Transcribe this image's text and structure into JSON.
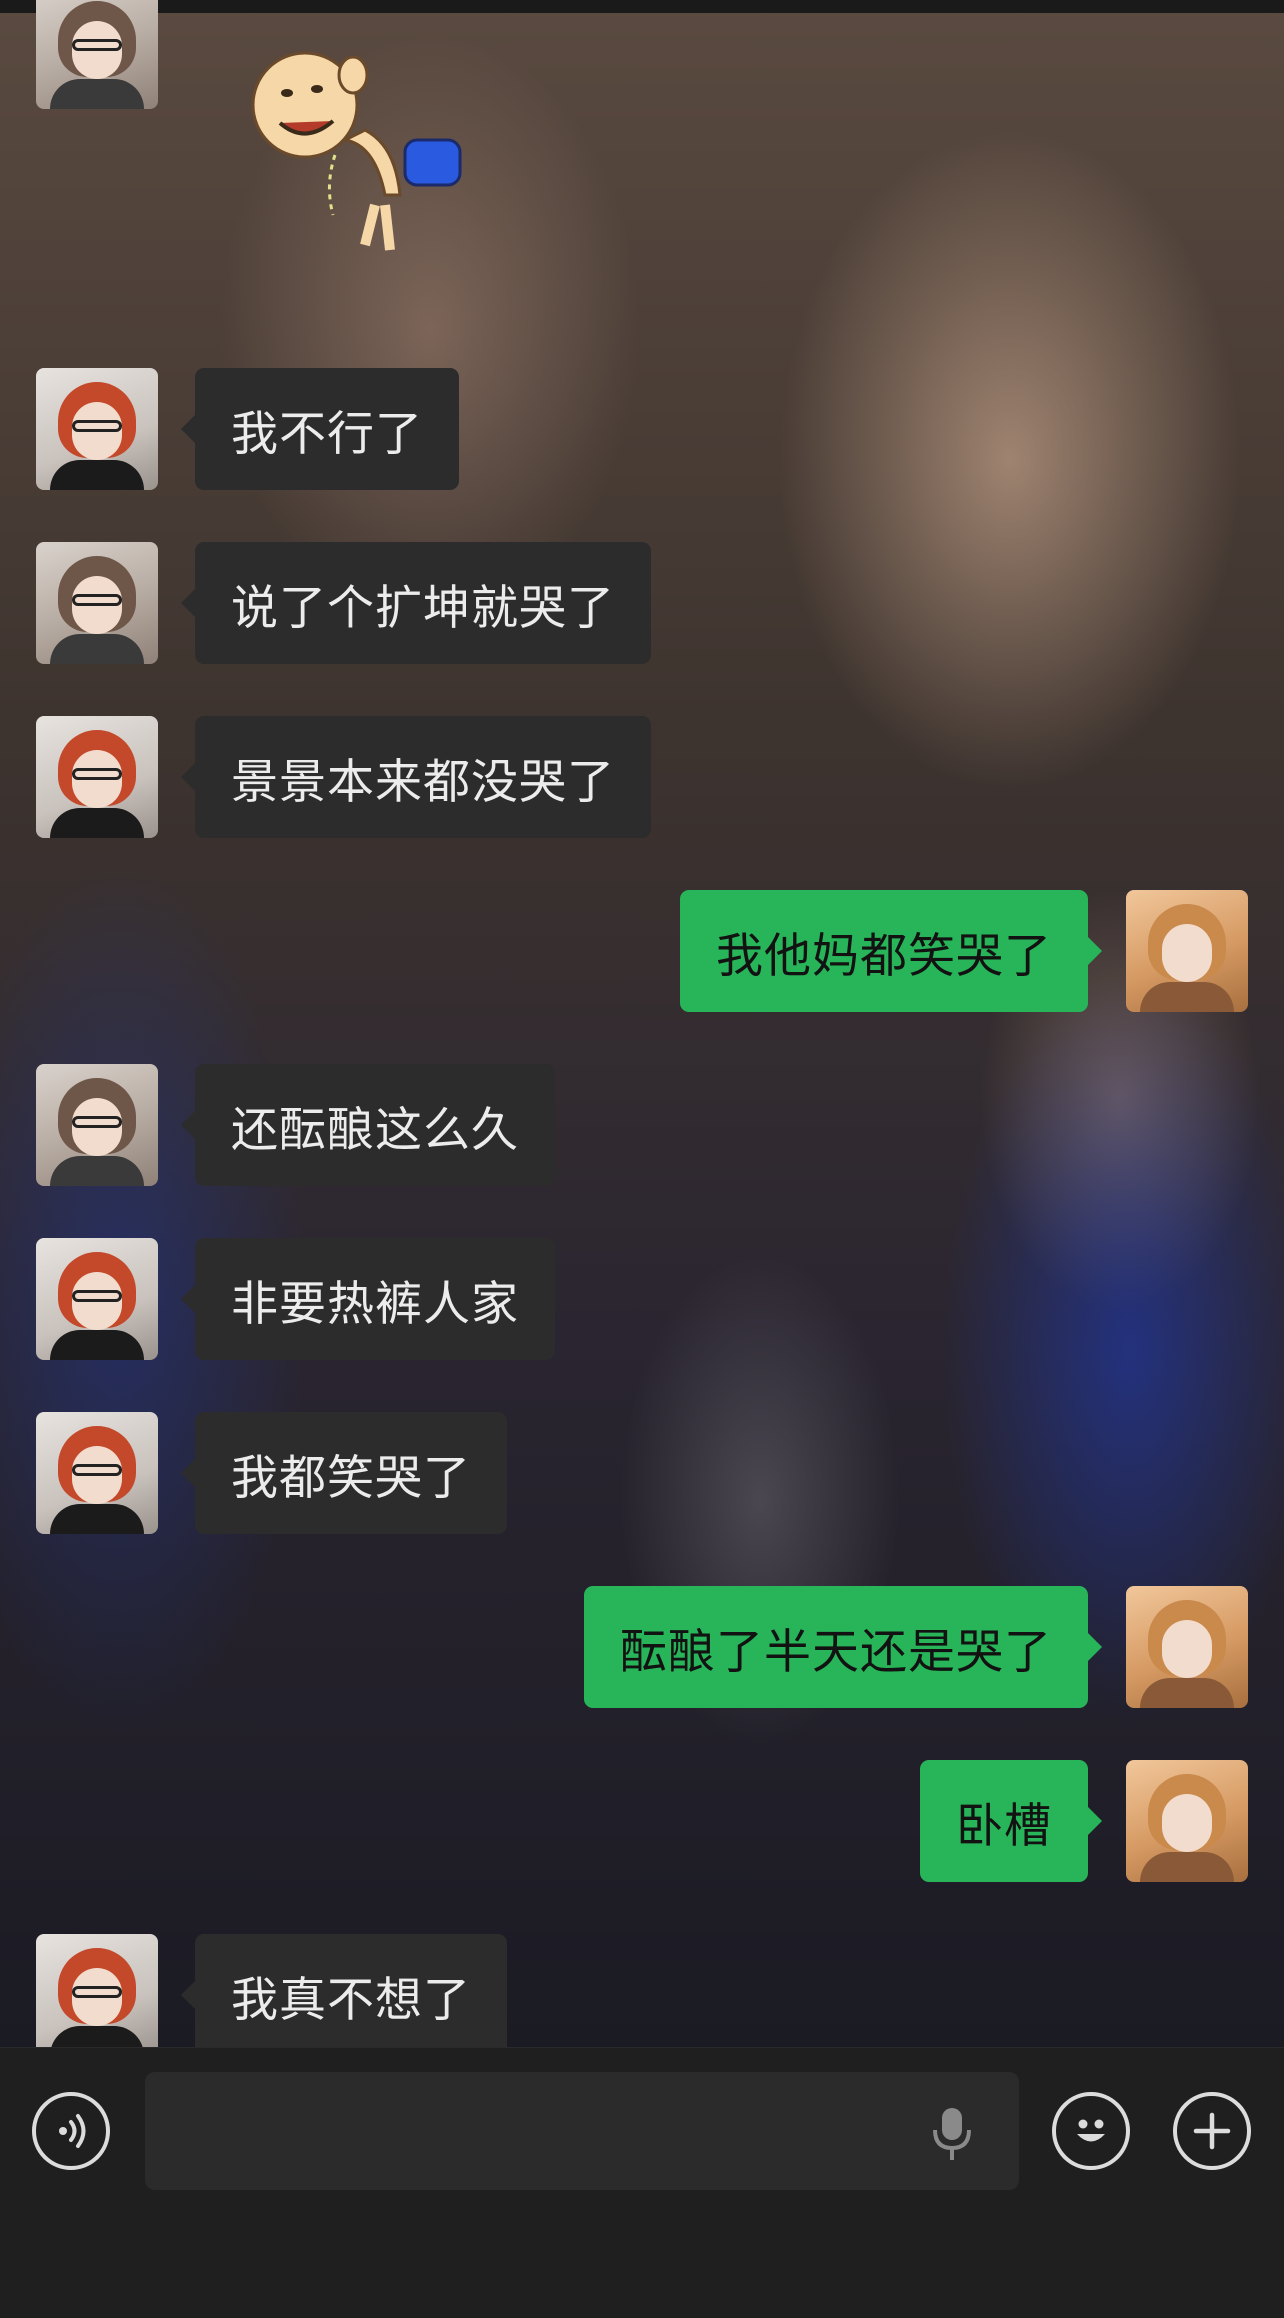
{
  "chat": {
    "messages": [
      {
        "sender": "glasses",
        "type": "sticker",
        "sticker": "cartoon-peeing-boy-sticker"
      },
      {
        "sender": "red",
        "type": "text",
        "text": "我不行了"
      },
      {
        "sender": "glasses",
        "type": "text",
        "text": "说了个扩坤就哭了"
      },
      {
        "sender": "red",
        "type": "text",
        "text": "景景本来都没哭了"
      },
      {
        "sender": "me",
        "type": "text",
        "text": "我他妈都笑哭了"
      },
      {
        "sender": "glasses",
        "type": "text",
        "text": "还酝酿这么久"
      },
      {
        "sender": "red",
        "type": "text",
        "text": "非要热裤人家"
      },
      {
        "sender": "red",
        "type": "text",
        "text": "我都笑哭了"
      },
      {
        "sender": "me",
        "type": "text",
        "text": "酝酿了半天还是哭了"
      },
      {
        "sender": "me",
        "type": "text",
        "text": "卧槽"
      },
      {
        "sender": "red",
        "type": "text",
        "text": "我真不想了"
      }
    ]
  },
  "input_bar": {
    "voice_toggle_icon": "voice-toggle-icon",
    "text_value": "",
    "mic_icon": "microphone-icon",
    "emoji_icon": "emoji-icon",
    "more_icon": "plus-icon"
  },
  "colors": {
    "incoming_bubble": "#2c2c2c",
    "outgoing_bubble": "#28b559",
    "input_background": "#1f1f1f"
  }
}
